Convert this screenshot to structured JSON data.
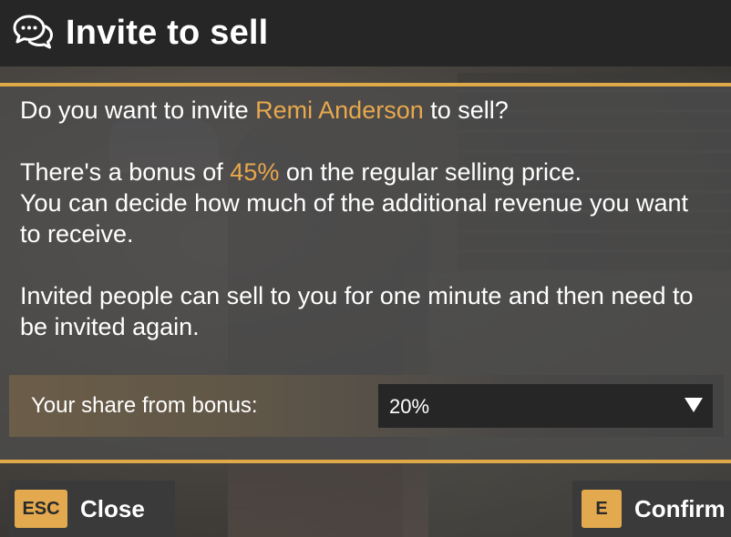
{
  "header": {
    "icon": "chat-bubbles-icon",
    "title": "Invite to sell"
  },
  "body": {
    "p1_pre": "Do you want to invite ",
    "p1_name": "Remi Anderson",
    "p1_post": " to sell?",
    "p2_pre": "There's a bonus of ",
    "p2_bonus": "45%",
    "p2_post": " on the regular selling price.",
    "p2_line2": "You can decide how much of the additional revenue you want to receive.",
    "p3": "Invited people can sell to you for one minute and then need to be invited again."
  },
  "share": {
    "label": "Your share from bonus:",
    "selected": "20%",
    "arrow_icon": "triangle-down-icon"
  },
  "buttons": {
    "close": {
      "key": "ESC",
      "label": "Close"
    },
    "confirm": {
      "key": "E",
      "label": "Confirm"
    }
  },
  "colors": {
    "accent": "#e0a947",
    "highlight": "#e8a84c",
    "header_bg": "#262626",
    "select_bg": "#262626"
  }
}
